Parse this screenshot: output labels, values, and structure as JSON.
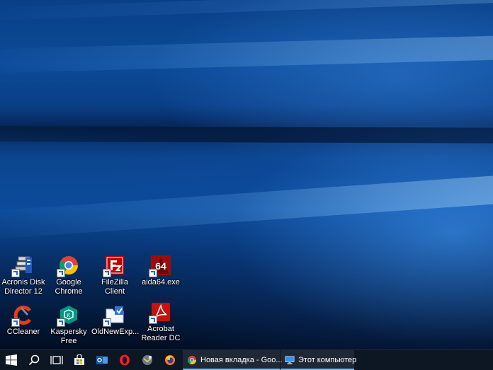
{
  "desktop": {
    "icons": [
      {
        "label": "Acronis Disk Director 12",
        "icon": "acronis-icon"
      },
      {
        "label": "Google Chrome",
        "icon": "chrome-icon"
      },
      {
        "label": "FileZilla Client",
        "icon": "filezilla-icon"
      },
      {
        "label": "aida64.exe",
        "icon": "aida64-icon"
      },
      {
        "label": "CCleaner",
        "icon": "ccleaner-icon"
      },
      {
        "label": "Kaspersky Free",
        "icon": "kaspersky-icon"
      },
      {
        "label": "OldNewExp...",
        "icon": "oldnewexplorer-icon"
      },
      {
        "label": "Acrobat Reader DC",
        "icon": "acrobat-icon"
      }
    ]
  },
  "taskbar": {
    "pinned": [
      "windows-start-icon",
      "search-icon",
      "task-view-icon",
      "store-icon",
      "outlook-icon",
      "opera-icon",
      "mail-icon",
      "firefox-icon"
    ],
    "tasks": [
      {
        "label": "Новая вкладка - Goo...",
        "icon": "chrome-icon"
      },
      {
        "label": "Этот компьютер",
        "icon": "this-pc-icon"
      }
    ]
  },
  "colors": {
    "taskbar_bg": "#0d1623",
    "accent": "#76b9ed",
    "wallpaper_blue": "#0b4a98"
  }
}
